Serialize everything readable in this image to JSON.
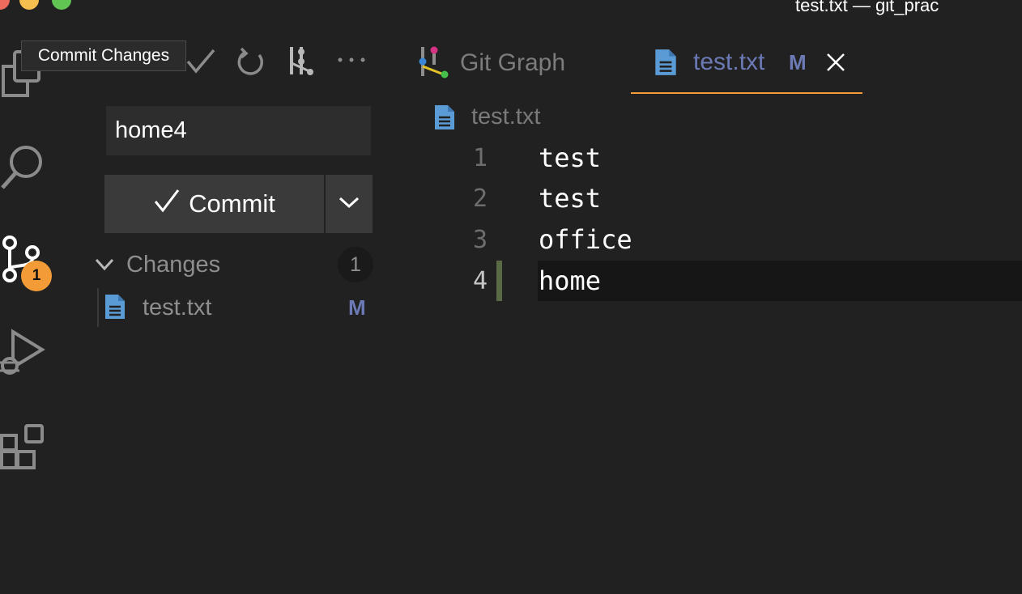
{
  "window": {
    "title": "test.txt — git_prac"
  },
  "tooltip": {
    "text": "Commit Changes"
  },
  "activity_bar": {
    "items": [
      {
        "name": "explorer",
        "icon": "files-icon"
      },
      {
        "name": "search",
        "icon": "search-icon"
      },
      {
        "name": "source-control",
        "icon": "source-control-icon",
        "badge": "1"
      },
      {
        "name": "run-debug",
        "icon": "run-debug-icon"
      },
      {
        "name": "extensions",
        "icon": "extensions-icon"
      }
    ]
  },
  "scm": {
    "toolbar": [
      "check-icon",
      "refresh-icon",
      "git-graph-icon",
      "more-icon"
    ],
    "message": "home4",
    "commit_label": "Commit",
    "changes": {
      "title": "Changes",
      "count": "1",
      "items": [
        {
          "name": "test.txt",
          "status": "M"
        }
      ]
    }
  },
  "tabs": [
    {
      "label": "Git Graph",
      "active": false
    },
    {
      "label": "test.txt",
      "status": "M",
      "active": true
    }
  ],
  "breadcrumb": {
    "file": "test.txt"
  },
  "editor": {
    "lines": [
      {
        "no": "1",
        "text": "test"
      },
      {
        "no": "2",
        "text": "test"
      },
      {
        "no": "3",
        "text": "office"
      },
      {
        "no": "4",
        "text": "home"
      }
    ]
  },
  "colors": {
    "accent": "#f39c37",
    "modified": "#6c7ab5",
    "file_icon": "#5b9bd5"
  }
}
